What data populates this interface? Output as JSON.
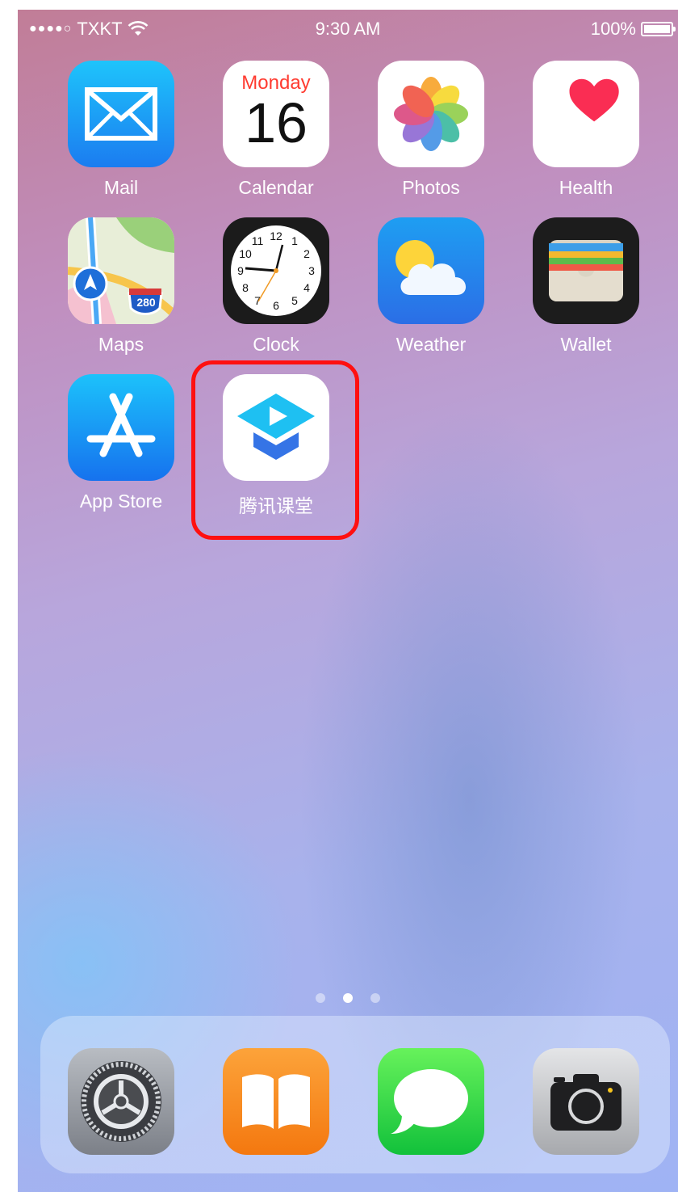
{
  "status_bar": {
    "signal": "●●●●○",
    "carrier": "TXKT",
    "time": "9:30 AM",
    "battery_percent": "100%"
  },
  "apps": [
    {
      "name": "Mail",
      "icon": "mail-icon"
    },
    {
      "name": "Calendar",
      "icon": "calendar-icon",
      "day_name": "Monday",
      "day_number": "16"
    },
    {
      "name": "Photos",
      "icon": "photos-icon"
    },
    {
      "name": "Health",
      "icon": "health-icon"
    },
    {
      "name": "Maps",
      "icon": "maps-icon",
      "shield_text": "280"
    },
    {
      "name": "Clock",
      "icon": "clock-icon",
      "numbers": [
        "12",
        "1",
        "2",
        "3",
        "4",
        "5",
        "6",
        "7",
        "8",
        "9",
        "10",
        "11"
      ]
    },
    {
      "name": "Weather",
      "icon": "weather-icon"
    },
    {
      "name": "Wallet",
      "icon": "wallet-icon"
    },
    {
      "name": "App Store",
      "icon": "app-store-icon"
    },
    {
      "name": "腾讯课堂",
      "icon": "tencent-classroom-icon",
      "highlighted": true
    }
  ],
  "page_indicator": {
    "total": 3,
    "active": 2
  },
  "dock": [
    {
      "name": "Settings",
      "icon": "settings-icon"
    },
    {
      "name": "Books",
      "icon": "books-icon"
    },
    {
      "name": "Messages",
      "icon": "messages-icon"
    },
    {
      "name": "Camera",
      "icon": "camera-icon"
    }
  ],
  "colors": {
    "highlight": "#ff1010",
    "calendar_red": "#ff3b30",
    "mail_blue": "#1e8cf4",
    "tencent_blue": "#1eb8f0"
  }
}
